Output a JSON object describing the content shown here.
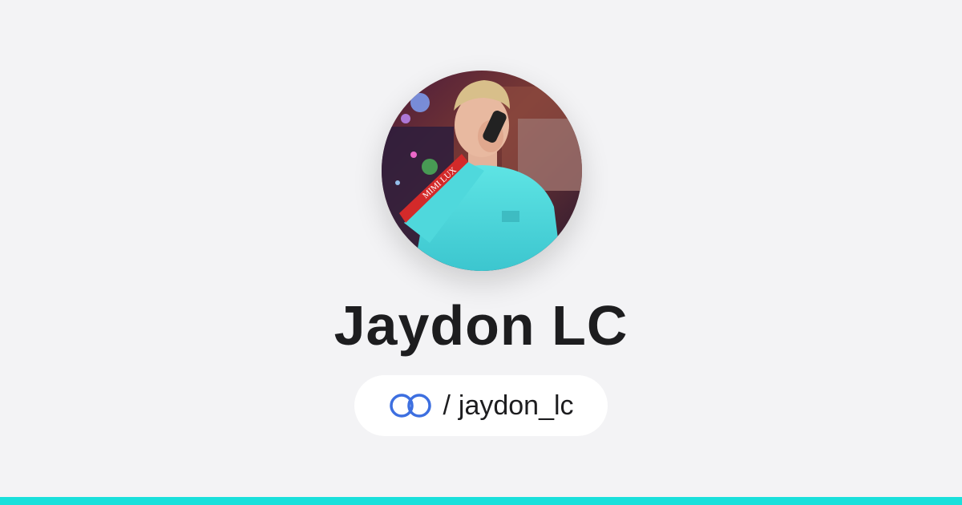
{
  "profile": {
    "display_name": "Jaydon LC",
    "handle_separator": "/",
    "handle": "jaydon_lc",
    "avatar": "profile-photo-performer-with-microphone",
    "sleeve_text": "MIMI LUX"
  },
  "brand": {
    "icon": "interlocked-rings-logo-icon",
    "icon_color": "#3d6fe0"
  },
  "theme": {
    "background": "#f3f3f5",
    "accent_bar": "#19e0db",
    "text": "#1d1d1f"
  }
}
